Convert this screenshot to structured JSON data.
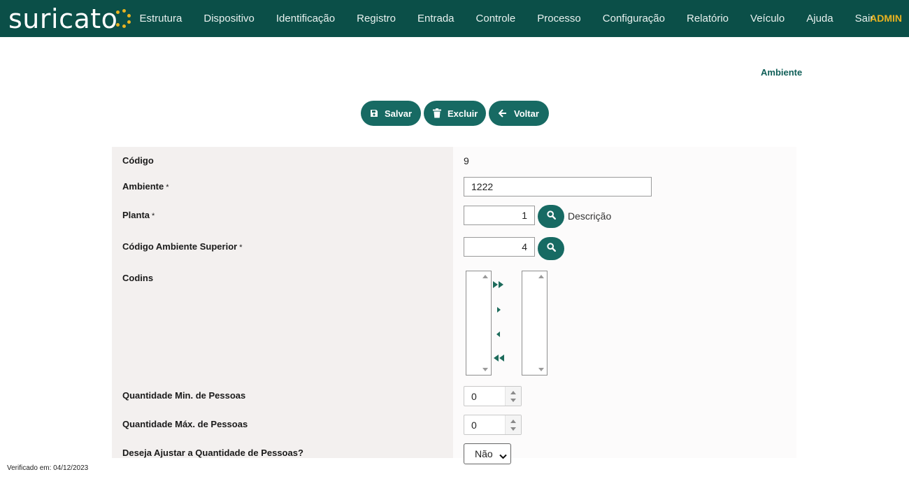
{
  "app": {
    "logo_text": "suricato",
    "brand_colors": {
      "primary": "#0b4f48",
      "button": "#176a63",
      "accent": "#e9b320"
    }
  },
  "nav": {
    "items": [
      "Estrutura",
      "Dispositivo",
      "Identificação",
      "Registro",
      "Entrada",
      "Controle",
      "Processo",
      "Configuração",
      "Relatório",
      "Veículo",
      "Ajuda",
      "Sair"
    ],
    "user": "ADMIN"
  },
  "page": {
    "title": "Ambiente"
  },
  "toolbar": {
    "save_label": "Salvar",
    "save_icon": "floppy-disk-icon",
    "delete_label": "Excluir",
    "delete_icon": "trash-icon",
    "back_label": "Voltar",
    "back_icon": "arrow-left-icon"
  },
  "form": {
    "codigo": {
      "label": "Código",
      "value": "9"
    },
    "ambiente": {
      "label": "Ambiente",
      "required_mark": "*",
      "value": "1222"
    },
    "planta": {
      "label": "Planta",
      "required_mark": "*",
      "value": "1",
      "description": "Descrição"
    },
    "codigo_ambiente_superior": {
      "label": "Código Ambiente Superior",
      "required_mark": "*",
      "value": "4"
    },
    "codins": {
      "label": "Codins",
      "available": [],
      "selected": []
    },
    "qtd_min": {
      "label": "Quantidade Min. de Pessoas",
      "value": "0"
    },
    "qtd_max": {
      "label": "Quantidade Máx. de Pessoas",
      "value": "0"
    },
    "ajustar": {
      "label": "Deseja Ajustar a Quantidade de Pessoas?",
      "selected": "Não"
    }
  },
  "footer": {
    "verified_text": "Verificado em: 04/12/2023"
  }
}
